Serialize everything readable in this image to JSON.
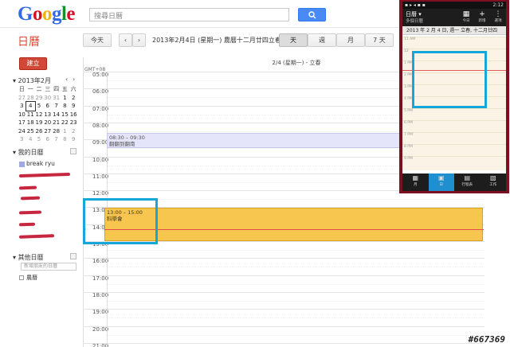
{
  "header": {
    "logo_letters": [
      {
        "ch": "G",
        "color": "#3369e8"
      },
      {
        "ch": "o",
        "color": "#d50f25"
      },
      {
        "ch": "o",
        "color": "#eeb211"
      },
      {
        "ch": "g",
        "color": "#3369e8"
      },
      {
        "ch": "l",
        "color": "#009925"
      },
      {
        "ch": "e",
        "color": "#d50f25"
      }
    ],
    "search_placeholder": "搜尋日曆",
    "search_icon": "magnifier-icon"
  },
  "app_title": "日曆",
  "toolbar": {
    "today": "今天",
    "prev": "‹",
    "next": "›",
    "date_range": "2013年2月4日 (星期一) 農曆十二月廿四立春",
    "views": [
      "天",
      "週",
      "月",
      "7 天"
    ],
    "active_view": "天"
  },
  "sidebar": {
    "create": "建立",
    "mini_cal": {
      "title": "2013年2月",
      "weekdays": [
        "日",
        "一",
        "二",
        "三",
        "四",
        "五",
        "六"
      ],
      "weeks": [
        [
          "27",
          "28",
          "29",
          "30",
          "31",
          "1",
          "2"
        ],
        [
          "3",
          "4",
          "5",
          "6",
          "7",
          "8",
          "9"
        ],
        [
          "10",
          "11",
          "12",
          "13",
          "14",
          "15",
          "16"
        ],
        [
          "17",
          "18",
          "19",
          "20",
          "21",
          "22",
          "23"
        ],
        [
          "24",
          "25",
          "26",
          "27",
          "28",
          "1",
          "2"
        ],
        [
          "3",
          "4",
          "5",
          "6",
          "7",
          "8",
          "9"
        ]
      ],
      "today": "4"
    },
    "my_calendars_title": "我的日曆",
    "my_calendars": [
      "break ryu"
    ],
    "other_calendars_title": "其他日曆",
    "add_placeholder": "新增朋友的日曆",
    "holidays": "農曆"
  },
  "day_view": {
    "day_header": "2/4 (星期一) - 立春",
    "timezone": "GMT+08",
    "hours": [
      "05:00",
      "06:00",
      "07:00",
      "08:00",
      "09:00",
      "10:00",
      "11:00",
      "12:00",
      "13:00",
      "14:00",
      "15:00",
      "16:00",
      "17:00",
      "18:00",
      "19:00",
      "20:00",
      "21:00"
    ],
    "events": [
      {
        "time": "08:30 – 09:30",
        "title": "翻翻到翻南",
        "color": "#e4e4fb"
      },
      {
        "time": "13:00 – 15:00",
        "title": "科學會",
        "color": "#f6c64e"
      }
    ]
  },
  "phone": {
    "status_time": "2:12",
    "title": "日曆",
    "subtitle": "多個日曆",
    "actions": [
      {
        "icon": "calendar-today-icon",
        "label": "今日"
      },
      {
        "icon": "plus-icon",
        "label": "新增"
      },
      {
        "icon": "more-vertical-icon",
        "label": "選項"
      }
    ],
    "date_bar": "2013 年 2 月 4 日, 週一 立春, 十二月廿四",
    "hours": [
      "11 AM",
      "12",
      "1 PM",
      "2 PM",
      "3 PM",
      "4 PM",
      "5 PM",
      "6 PM",
      "7 PM",
      "8 PM",
      "9 PM"
    ],
    "tabs": [
      {
        "icon": "month-grid-icon",
        "label": "月"
      },
      {
        "icon": "day-icon",
        "label": "日"
      },
      {
        "icon": "agenda-icon",
        "label": "行程表"
      },
      {
        "icon": "tasks-icon",
        "label": "工作"
      }
    ],
    "active_tab": "日"
  },
  "accent_color": "#17a6d9",
  "watermark": "#667369"
}
